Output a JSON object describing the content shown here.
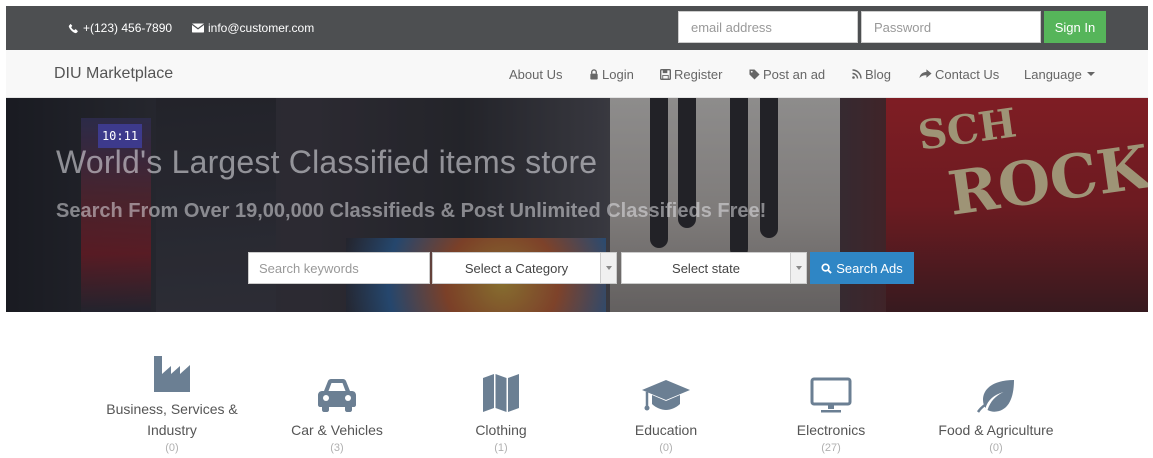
{
  "topbar": {
    "phone": "+(123) 456-7890",
    "email": "info@customer.com",
    "email_placeholder": "email address",
    "password_placeholder": "Password",
    "signin_label": "Sign In",
    "signin_color": "#56b55a",
    "background": "#4d4f51"
  },
  "navbar": {
    "brand": "DIU Marketplace",
    "items": [
      {
        "label": "About Us",
        "icon": null
      },
      {
        "label": "Login",
        "icon": "lock-icon"
      },
      {
        "label": "Register",
        "icon": "floppy-disk-icon"
      },
      {
        "label": "Post an ad",
        "icon": "tag-icon"
      },
      {
        "label": "Blog",
        "icon": "rss-icon"
      },
      {
        "label": "Contact Us",
        "icon": "share-arrow-icon"
      },
      {
        "label": "Language",
        "icon": "caret-down-icon"
      }
    ]
  },
  "hero": {
    "title": "World's Largest Classified items store",
    "subtitle": "Search From Over 19,00,000 Classifieds & Post Unlimited Classifieds Free!",
    "clock": "10:11",
    "search": {
      "keyword_placeholder": "Search keywords",
      "category_selected": "Select a Category",
      "state_selected": "Select state",
      "button_label": "Search Ads",
      "button_color": "#2f86c5"
    }
  },
  "categories": [
    {
      "name": "Business, Services & Industry",
      "count": "(0)",
      "icon": "factory-icon"
    },
    {
      "name": "Car & Vehicles",
      "count": "(3)",
      "icon": "car-icon"
    },
    {
      "name": "Clothing",
      "count": "(1)",
      "icon": "map-icon"
    },
    {
      "name": "Education",
      "count": "(0)",
      "icon": "graduation-cap-icon"
    },
    {
      "name": "Electronics",
      "count": "(27)",
      "icon": "monitor-icon"
    },
    {
      "name": "Food & Agriculture",
      "count": "(0)",
      "icon": "leaf-icon"
    }
  ],
  "icon_color": "#6b7f93"
}
